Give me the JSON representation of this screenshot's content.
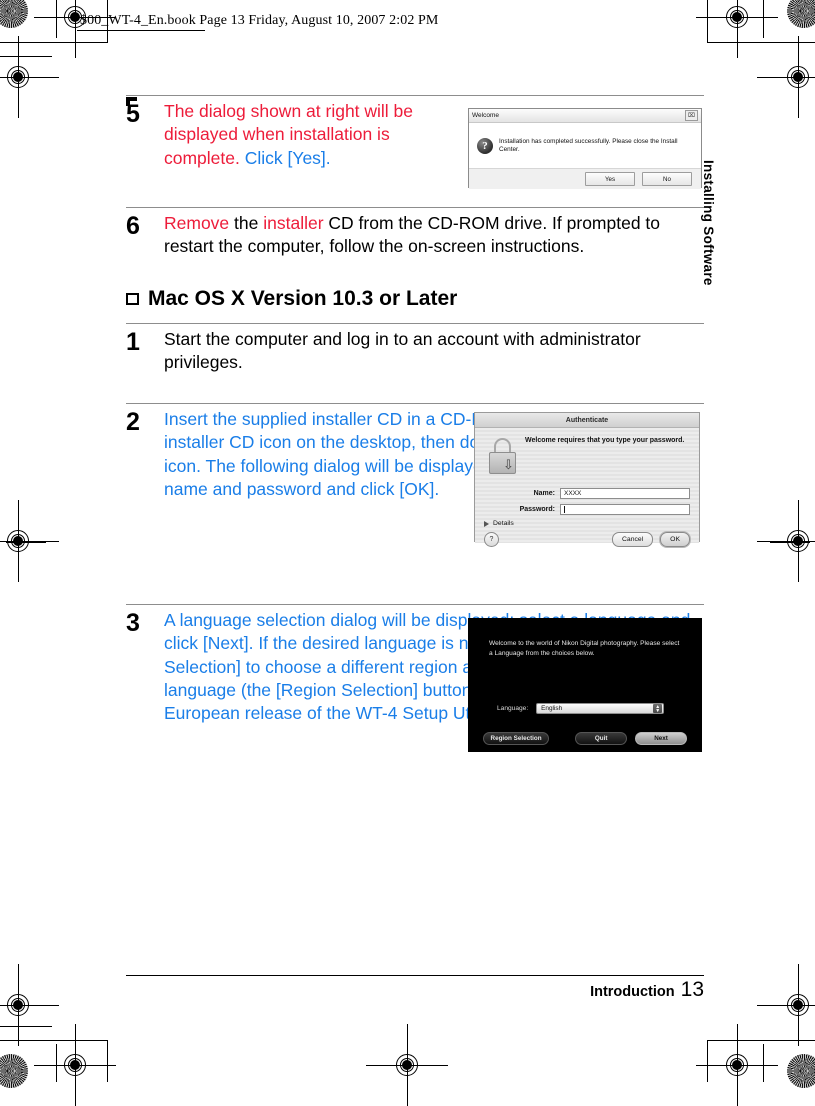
{
  "slug": "$00_WT-4_En.book  Page 13  Friday, August 10, 2007  2:02 PM",
  "side_tab": "Installing Software",
  "footer": {
    "label": "Introduction",
    "page": "13"
  },
  "colors": {
    "red": "#ed1c3a",
    "blue": "#1a7ee8",
    "black": "#000000"
  },
  "steps": [
    {
      "num": "5",
      "runs": [
        {
          "text": "The dialog shown at right will be displayed when installation is complete.  ",
          "color": "red"
        },
        {
          "text": "Click [Yes].",
          "color": "blue"
        }
      ]
    },
    {
      "num": "6",
      "runs": [
        {
          "text": "Remove",
          "color": "red"
        },
        {
          "text": " the ",
          "color": "black"
        },
        {
          "text": "installer",
          "color": "red"
        },
        {
          "text": " CD from the CD-ROM drive.  If prompted to restart the computer, follow the on-screen instructions.",
          "color": "black"
        }
      ]
    },
    {
      "num": "1",
      "runs": [
        {
          "text": "Start the computer and log in to an account with administrator privileges.",
          "color": "black"
        }
      ]
    },
    {
      "num": "2",
      "runs": [
        {
          "text": "Insert the supplied installer CD in a CD-ROM drive.  Double-click the installer CD icon on the desktop, then double-click the [Welcome] icon.  The following dialog will be displayed; enter an administrator name and password and click [OK].",
          "color": "blue"
        }
      ]
    },
    {
      "num": "3",
      "runs": [
        {
          "text": "A language selection dialog will be displayed; select a language and click [Next]. If the desired language is not available, click [Region Selection] to choose a different region and then choose the desired language (the [Region Selection] button is not available in the European release of the WT-4 Setup Utility/Thumbnail Selector).",
          "color": "blue"
        }
      ]
    }
  ],
  "section_heading": "Mac OS X Version 10.3 or Later",
  "figures": {
    "welcome_dialog": {
      "title": "Welcome",
      "close_label": "⌧",
      "icon": "question-mark",
      "message": "Installation has completed successfully. Please close the Install Center.",
      "buttons": [
        "Yes",
        "No"
      ]
    },
    "authenticate_dialog": {
      "title": "Authenticate",
      "message": "Welcome requires that you type your password.",
      "name_label": "Name:",
      "name_value": "XXXX",
      "password_label": "Password:",
      "password_value": "",
      "details_label": "Details",
      "help_label": "?",
      "buttons": [
        "Cancel",
        "OK"
      ]
    },
    "language_dialog": {
      "message": "Welcome to the world of Nikon Digital photography. Please select a Language from the choices below.",
      "language_label": "Language:",
      "language_value": "English",
      "buttons": [
        "Region Selection",
        "Quit",
        "Next"
      ]
    }
  }
}
